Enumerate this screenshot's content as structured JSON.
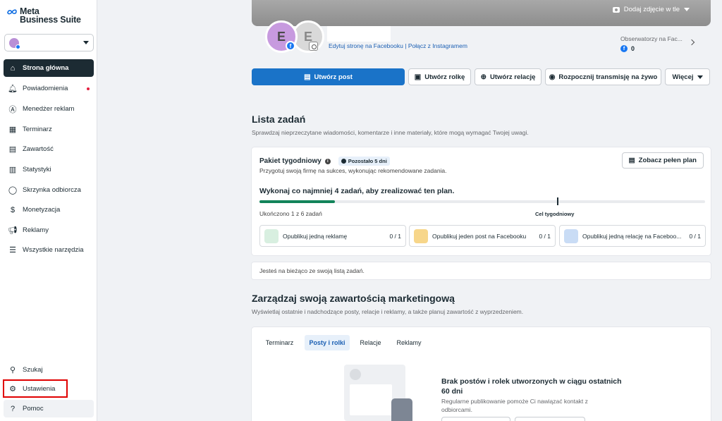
{
  "sidebar": {
    "brand_line1": "Meta",
    "brand_line2": "Business Suite",
    "nav": [
      {
        "label": "Strona główna",
        "icon": "home-icon"
      },
      {
        "label": "Powiadomienia",
        "icon": "bell-icon"
      },
      {
        "label": "Menedżer reklam",
        "icon": "ads-manager-icon"
      },
      {
        "label": "Terminarz",
        "icon": "calendar-icon"
      },
      {
        "label": "Zawartość",
        "icon": "content-icon"
      },
      {
        "label": "Statystyki",
        "icon": "stats-icon"
      },
      {
        "label": "Skrzynka odbiorcza",
        "icon": "inbox-icon"
      },
      {
        "label": "Monetyzacja",
        "icon": "money-icon"
      },
      {
        "label": "Reklamy",
        "icon": "megaphone-icon"
      },
      {
        "label": "Wszystkie narzędzia",
        "icon": "menu-icon"
      }
    ],
    "bottom": [
      {
        "label": "Szukaj",
        "icon": "search-icon"
      },
      {
        "label": "Ustawienia",
        "icon": "gear-icon"
      },
      {
        "label": "Pomoc",
        "icon": "help-icon"
      }
    ]
  },
  "header": {
    "cover_button": "Dodaj zdjęcie w tle",
    "avatar_letter_1": "E",
    "avatar_letter_2": "E",
    "edit_link": "Edytuj stronę na Facebooku",
    "separator": "|",
    "connect_link": "Połącz z Instagramem",
    "followers_label": "Obserwatorzy na Fac...",
    "followers_count": "0"
  },
  "actions": {
    "create_post": "Utwórz post",
    "create_reel": "Utwórz rolkę",
    "create_story": "Utwórz relację",
    "go_live": "Rozpocznij transmisję na żywo",
    "more": "Więcej"
  },
  "tasks": {
    "title": "Lista zadań",
    "subtitle": "Sprawdzaj nieprzeczytane wiadomości, komentarze i inne materiały, które mogą wymagać Twojej uwagi.",
    "package_title": "Pakiet tygodniowy",
    "remaining": "Pozostało 5 dni",
    "package_sub": "Przygotuj swoją firmę na sukces, wykonując rekomendowane zadania.",
    "plan_button": "Zobacz pełen plan",
    "goal": "Wykonaj co najmniej 4 zadań, aby zrealizować ten plan.",
    "progress_fraction": 0.17,
    "done_text": "Ukończono 1 z 6 zadań",
    "goal_marker": "Cel tygodniowy",
    "items": [
      {
        "label": "Opublikuj jedną reklamę",
        "count": "0 / 1",
        "color": "#3a9b5c"
      },
      {
        "label": "Opublikuj jeden post na Facebooku",
        "count": "0 / 1",
        "color": "#e8a93c"
      },
      {
        "label": "Opublikuj jedną relację na Faceboo...",
        "count": "0 / 1",
        "color": "#5b8ed8"
      }
    ],
    "status": "Jesteś na bieżąco ze swoją listą zadań."
  },
  "marketing": {
    "title": "Zarządzaj swoją zawartością marketingową",
    "subtitle": "Wyświetlaj ostatnie i nadchodzące posty, relacje i reklamy, a także planuj zawartość z wyprzedzeniem.",
    "tabs": [
      "Terminarz",
      "Posty i rolki",
      "Relacje",
      "Reklamy"
    ],
    "empty_title": "Brak postów i rolek utworzonych w ciągu ostatnich 60 dni",
    "empty_sub": "Regularne publikowanie pomoże Ci nawiązać kontakt z odbiorcami."
  },
  "colors": {
    "accent": "#1a73c8",
    "progress": "#12845a",
    "highlight": "#e00000"
  }
}
